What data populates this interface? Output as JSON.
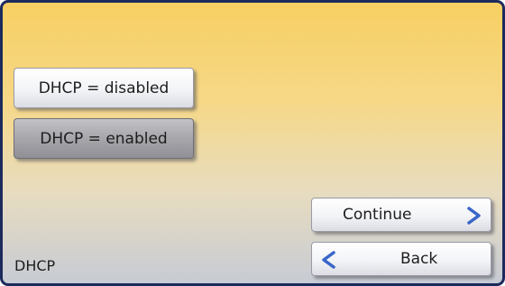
{
  "options": {
    "disabled_label": "DHCP = disabled",
    "enabled_label": "DHCP = enabled",
    "selected": "enabled"
  },
  "navigation": {
    "continue_label": "Continue",
    "back_label": "Back"
  },
  "screen_title": "DHCP",
  "colors": {
    "frame": "#1c2a5c",
    "arrow": "#3a66c8",
    "gradient_top": "#f7cf63",
    "gradient_bottom": "#c7cbd4"
  },
  "icons": {
    "continue": "chevron-right-icon",
    "back": "chevron-left-icon"
  }
}
